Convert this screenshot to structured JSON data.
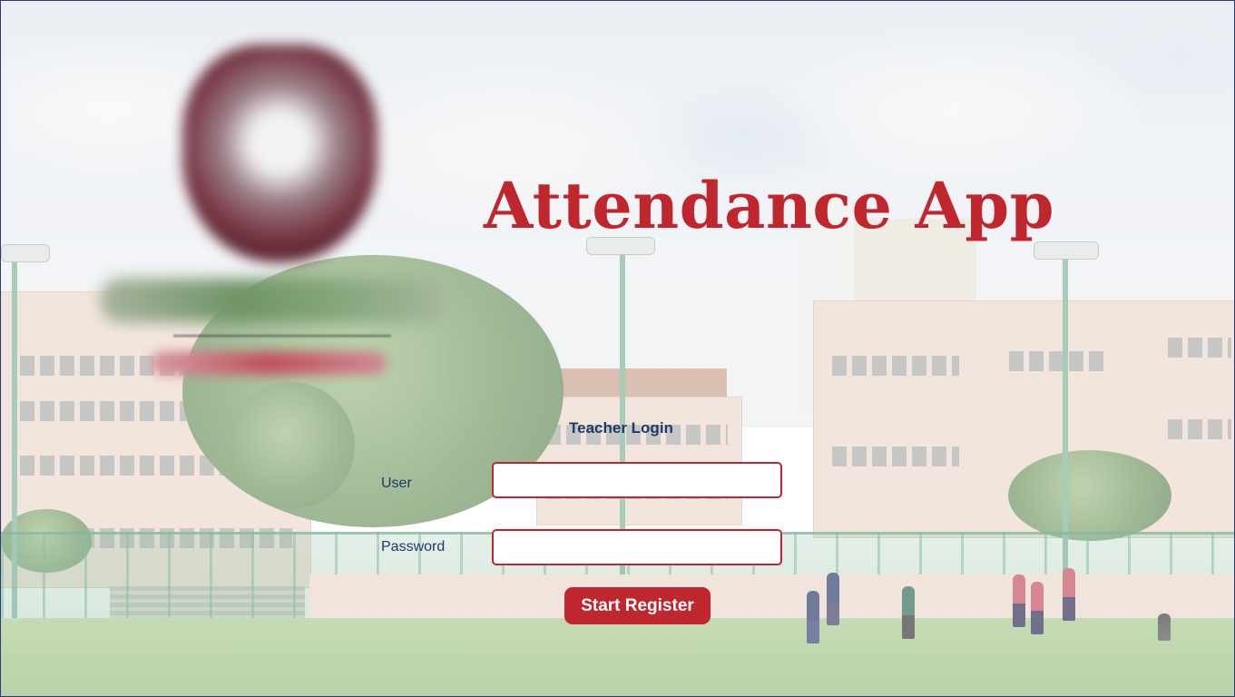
{
  "app": {
    "title": "Attendance App"
  },
  "login": {
    "heading": "Teacher Login",
    "user_label": "User",
    "user_value": "",
    "password_label": "Password",
    "password_value": "",
    "submit_label": "Start Register"
  },
  "colors": {
    "accent": "#c0262d",
    "label_text": "#1f3a66",
    "input_bg": "#ffffff"
  },
  "background": {
    "description_icon": "school-campus-photo"
  },
  "branding": {
    "crest_icon": "school-crest-logo-blurred"
  }
}
